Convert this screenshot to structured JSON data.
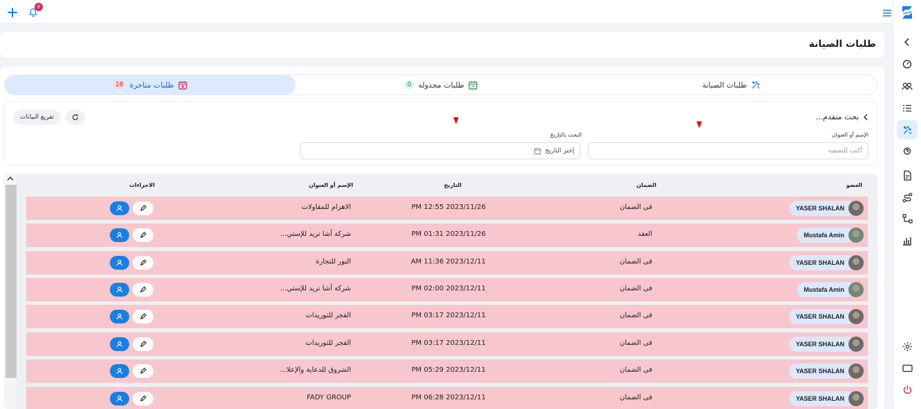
{
  "topbar": {
    "notifications_count": "6"
  },
  "page": {
    "title": "طلبات الصيانة"
  },
  "tabs": [
    {
      "label": "طلبات الصيانة",
      "icon": "tools-icon",
      "count": ""
    },
    {
      "label": "طلبات مجدولة",
      "icon": "calendar-icon",
      "count": "0"
    },
    {
      "label": "طلبات متاخرة",
      "icon": "calendar-x-icon",
      "count": "18"
    }
  ],
  "search": {
    "title": "بحث متقدم...",
    "name_label": "الإسم أو العنوان",
    "name_placeholder": "أكتب للتصفية",
    "date_label": "البحث بالتاريخ",
    "date_placeholder": "إختر التاريخ",
    "clear_label": "تفريغ البيانات"
  },
  "table": {
    "headers": {
      "member": "العضو",
      "warranty": "الضمان",
      "date": "التاريخ",
      "name": "الإسم أو العنوان",
      "actions": "الاجراءات"
    },
    "rows": [
      {
        "member": "YASER SHALAN",
        "warranty": "فى الضمان",
        "date": "PM 12:55 2023/11/26",
        "name": "الاهرام للمقاولات"
      },
      {
        "member": "Mustafa Amin",
        "warranty": "العقد",
        "date": "PM 01:31 2023/11/26",
        "name": "شركة أشا تريد للإستي..."
      },
      {
        "member": "YASER SHALAN",
        "warranty": "فى الضمان",
        "date": "AM 11:36 2023/12/11",
        "name": "النور للتجارة"
      },
      {
        "member": "Mustafa Amin",
        "warranty": "فى الضمان",
        "date": "PM 02:00 2023/12/11",
        "name": "شركة أشا تريد للإستي..."
      },
      {
        "member": "YASER SHALAN",
        "warranty": "فى الضمان",
        "date": "PM 03:17 2023/12/11",
        "name": "الفجر للتوريدات"
      },
      {
        "member": "YASER SHALAN",
        "warranty": "فى الضمان",
        "date": "PM 03:17 2023/12/11",
        "name": "الفجر للتوريدات"
      },
      {
        "member": "YASER SHALAN",
        "warranty": "فى الضمان",
        "date": "PM 05:29 2023/12/11",
        "name": "الشروق للدعاية والإعلا..."
      },
      {
        "member": "YASER SHALAN",
        "warranty": "فى الضمان",
        "date": "PM 06:28 2023/12/11",
        "name": "FADY GROUP"
      }
    ]
  },
  "colors": {
    "accent": "#1a7fe0",
    "row_overdue": "#f8c6cd",
    "tab_active": "#dbeafe",
    "logo": "#1c7ee8"
  }
}
